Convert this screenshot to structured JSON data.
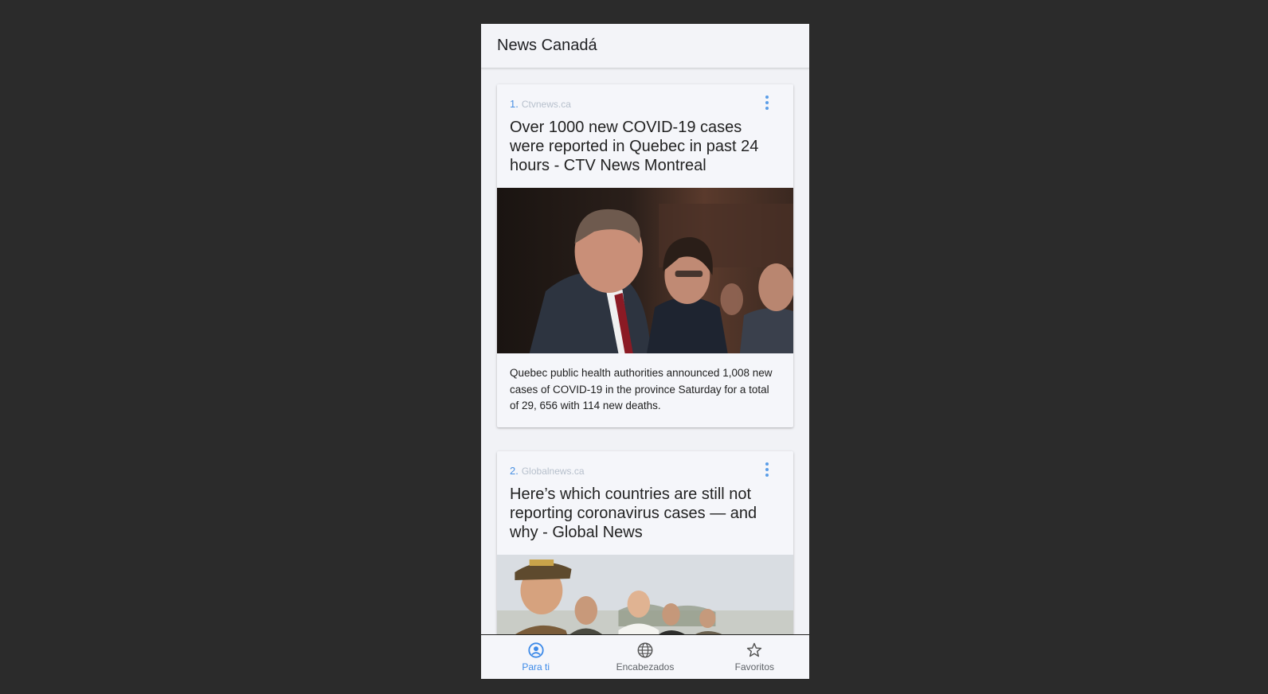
{
  "app": {
    "title": "News Canadá"
  },
  "articles": [
    {
      "rank": "1.",
      "source": "Ctvnews.ca",
      "headline": "Over 1000 new COVID-19 cases were reported in Quebec in past 24 hours - CTV News Montreal",
      "description": "Quebec public health authorities announced 1,008 new cases of COVID-19 in the province Saturday for a total of 29, 656 with 114 new deaths."
    },
    {
      "rank": "2.",
      "source": "Globalnews.ca",
      "headline": "Here’s which countries are still not reporting coronavirus cases — and why - Global News",
      "description": ""
    }
  ],
  "nav": {
    "items": [
      {
        "label": "Para ti",
        "icon": "account-circle-icon",
        "active": true
      },
      {
        "label": "Encabezados",
        "icon": "globe-icon",
        "active": false
      },
      {
        "label": "Favoritos",
        "icon": "star-icon",
        "active": false
      }
    ]
  },
  "colors": {
    "accent": "#3d8ae8",
    "background": "#2b2b2b",
    "surface": "#f1f2f6"
  }
}
